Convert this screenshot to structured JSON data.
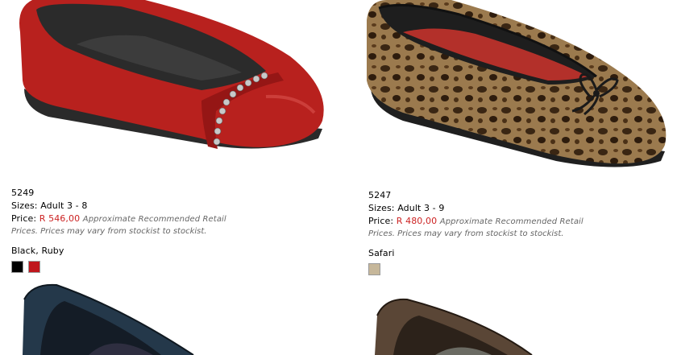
{
  "products": [
    {
      "code": "5249",
      "sizes_label": "Sizes:",
      "sizes_value": "Adult 3 - 8",
      "price_label": "Price:",
      "price_amount": "R 546,00",
      "price_note": "Approximate Recommended Retail",
      "disclaimer": "Prices. Prices may vary from stockist to stockist.",
      "colors_label": "Black, Ruby",
      "swatches": [
        {
          "name": "Black",
          "color": "#000000"
        },
        {
          "name": "Ruby",
          "color": "#c0161c"
        }
      ]
    },
    {
      "code": "5247",
      "sizes_label": "Sizes:",
      "sizes_value": "Adult 3 - 9",
      "price_label": "Price:",
      "price_amount": "R 480,00",
      "price_note": "Approximate Recommended Retail",
      "disclaimer": "Prices. Prices may vary from stockist to stockist.",
      "colors_label": "Safari",
      "swatches": [
        {
          "name": "Safari",
          "color": "#c6b79a"
        }
      ]
    }
  ]
}
